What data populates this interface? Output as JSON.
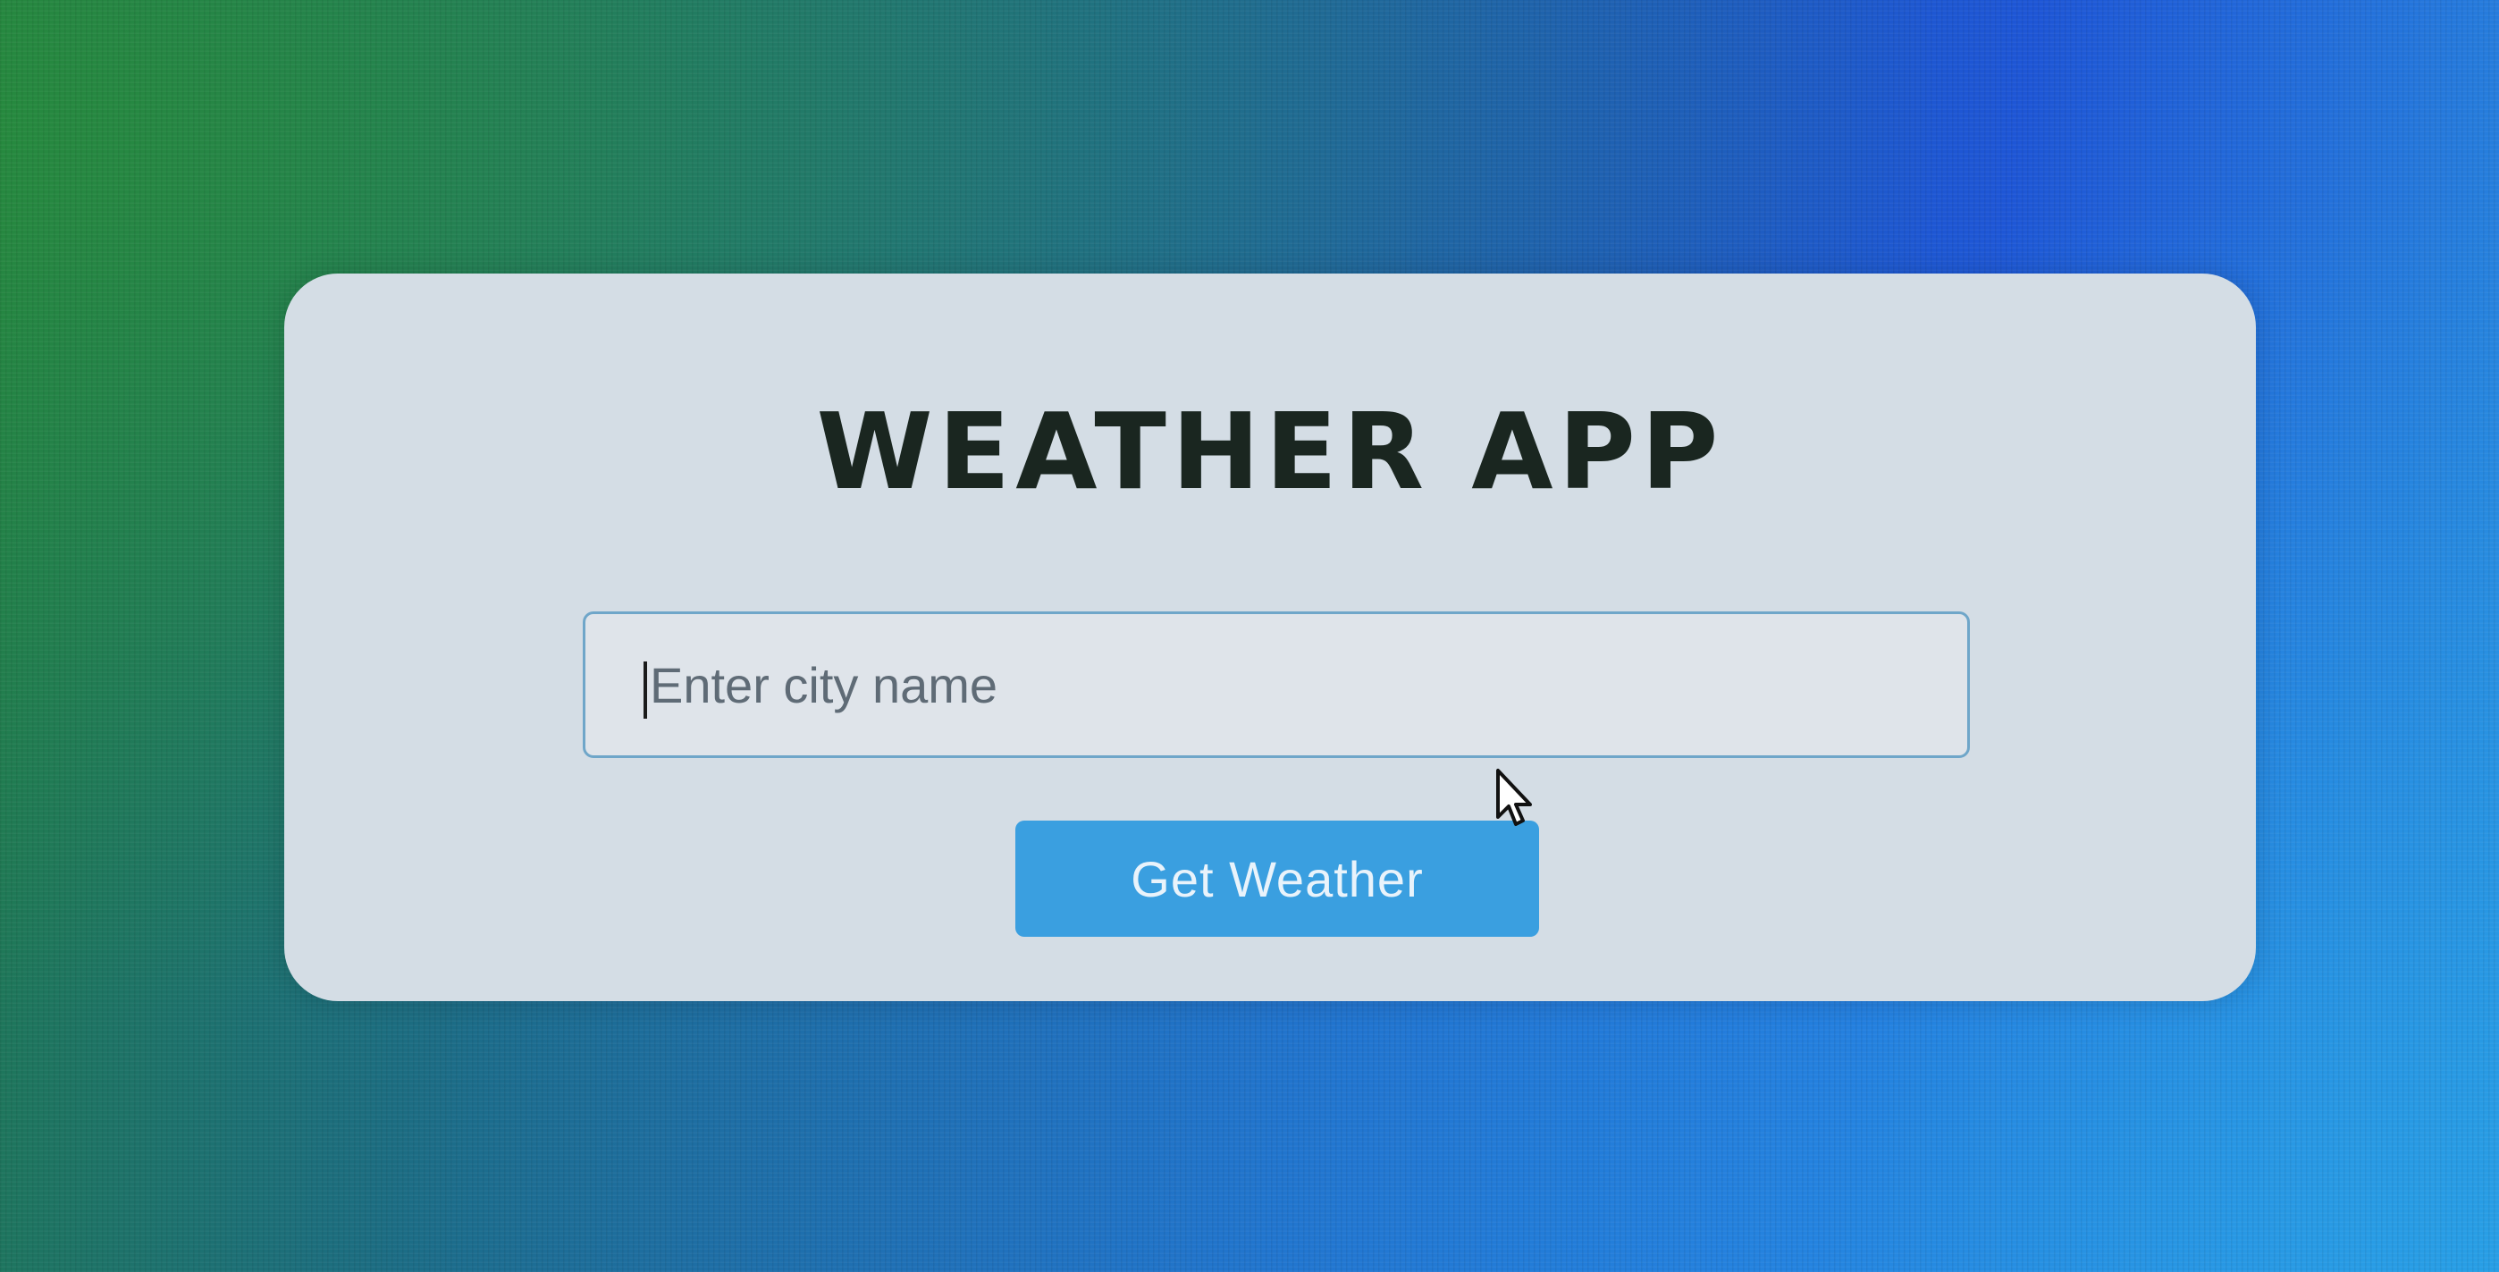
{
  "app": {
    "title": "WEATHER APP"
  },
  "search": {
    "placeholder": "Enter city name",
    "value": ""
  },
  "actions": {
    "get_weather_label": "Get Weather"
  },
  "colors": {
    "card_background": "#d4dde5",
    "button_background": "#3a9fe0",
    "input_border": "#6fa6c9",
    "title_text": "#1a2620"
  },
  "icons": {
    "pointer": "mouse-pointer-icon"
  }
}
